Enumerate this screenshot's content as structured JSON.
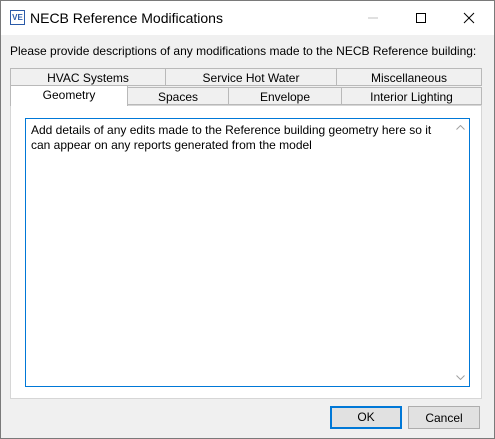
{
  "window": {
    "title": "NECB Reference Modifications",
    "app_icon_text": "VE",
    "controls": {
      "minimize": "minimize-icon",
      "maximize": "maximize-icon",
      "close": "close-icon"
    }
  },
  "prompt": "Please provide descriptions of any modifications made to the NECB Reference building:",
  "tabs": {
    "row_back": [
      "HVAC Systems",
      "Service Hot Water",
      "Miscellaneous"
    ],
    "row_front": [
      "Geometry",
      "Spaces",
      "Envelope",
      "Interior Lighting"
    ],
    "selected": "Geometry"
  },
  "textarea": {
    "value": "Add details of any edits made to the Reference building geometry here so it can appear on any reports generated from the model"
  },
  "buttons": {
    "ok": "OK",
    "cancel": "Cancel"
  },
  "colors": {
    "accent": "#0078d7",
    "dialog_bg": "#f0f0f0",
    "button_bg": "#e1e1e1"
  }
}
